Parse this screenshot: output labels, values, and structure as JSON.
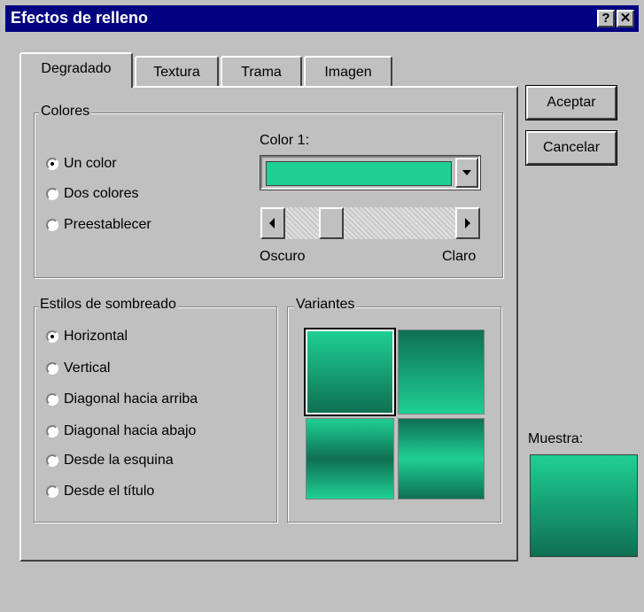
{
  "window": {
    "title": "Efectos de relleno",
    "help_button": "?",
    "close_button": "✕"
  },
  "tabs": [
    {
      "label": "Degradado",
      "active": true
    },
    {
      "label": "Textura",
      "active": false
    },
    {
      "label": "Trama",
      "active": false
    },
    {
      "label": "Imagen",
      "active": false
    }
  ],
  "buttons": {
    "ok": "Aceptar",
    "cancel": "Cancelar"
  },
  "colores": {
    "group_label": "Colores",
    "options": [
      {
        "label": "Un color",
        "checked": true
      },
      {
        "label": "Dos colores",
        "checked": false
      },
      {
        "label": "Preestablecer",
        "checked": false
      }
    ],
    "color1_label": "Color 1:",
    "color1_value": "#1fcf94",
    "slider_min_label": "Oscuro",
    "slider_max_label": "Claro",
    "slider_position": 0.25
  },
  "sombreado": {
    "group_label": "Estilos de sombreado",
    "options": [
      {
        "label": "Horizontal",
        "checked": true
      },
      {
        "label": "Vertical",
        "checked": false
      },
      {
        "label": "Diagonal hacia arriba",
        "checked": false
      },
      {
        "label": "Diagonal hacia abajo",
        "checked": false
      },
      {
        "label": "Desde la esquina",
        "checked": false
      },
      {
        "label": "Desde el título",
        "checked": false
      }
    ]
  },
  "variantes": {
    "group_label": "Variantes",
    "selected_index": 0
  },
  "muestra": {
    "label": "Muestra:"
  },
  "colors": {
    "dialog_bg": "#c0c0c0",
    "titlebar": "#000080",
    "gradient_light": "#1fcf94",
    "gradient_dark": "#0f6f52"
  }
}
